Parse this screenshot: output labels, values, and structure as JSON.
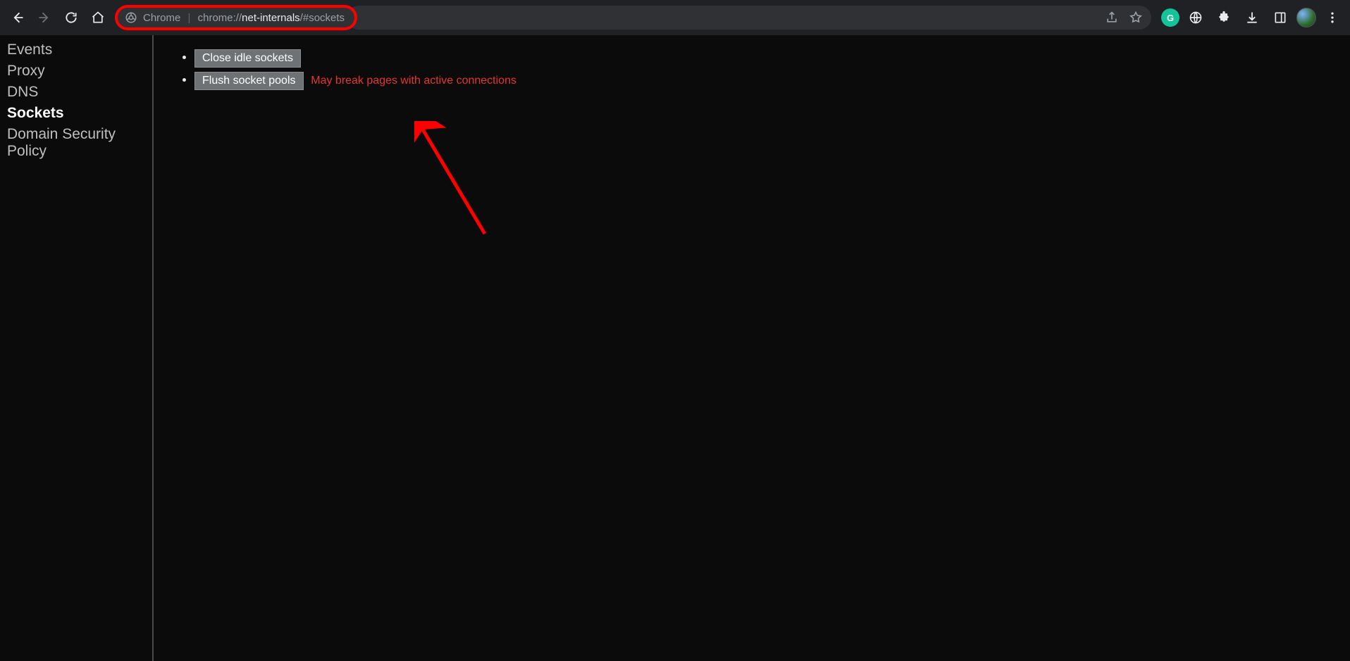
{
  "omnibox": {
    "origin_label": "Chrome",
    "url_prefix": "chrome://",
    "url_host": "net-internals",
    "url_suffix": "/#sockets"
  },
  "sidebar": {
    "items": [
      {
        "label": "Events",
        "active": false
      },
      {
        "label": "Proxy",
        "active": false
      },
      {
        "label": "DNS",
        "active": false
      },
      {
        "label": "Sockets",
        "active": true
      },
      {
        "label": "Domain Security Policy",
        "active": false
      }
    ]
  },
  "content": {
    "close_idle_label": "Close idle sockets",
    "flush_pools_label": "Flush socket pools",
    "flush_warning": "May break pages with active connections"
  },
  "extensions": {
    "grammarly_letter": "G"
  }
}
